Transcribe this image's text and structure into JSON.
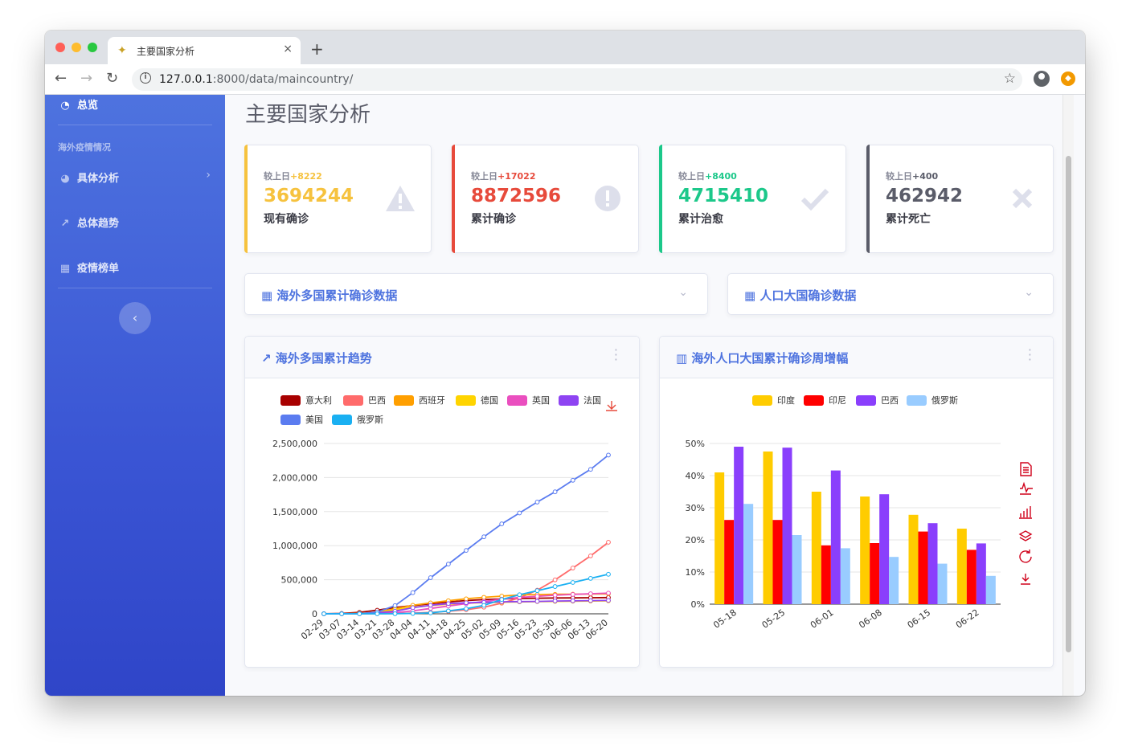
{
  "browser": {
    "tab_title": "主要国家分析",
    "url_host": "127.0.0.1",
    "url_rest": ":8000/data/maincountry/",
    "new_tab_symbol": "+",
    "close_symbol": "×",
    "icons": [
      "back-arrow-icon",
      "forward-arrow-icon",
      "reload-icon",
      "info-icon",
      "star-icon",
      "account-icon",
      "extension-icon"
    ]
  },
  "sidebar": {
    "dashboard_label": "总览",
    "section_heading": "海外疫情情况",
    "items": [
      {
        "label": "具体分析",
        "icon": "pie-chart-icon"
      },
      {
        "label": "总体趋势",
        "icon": "line-chart-icon"
      },
      {
        "label": "疫情榜单",
        "icon": "table-icon"
      }
    ],
    "toggle_icon": "chevron-left-icon"
  },
  "page": {
    "title": "主要国家分析"
  },
  "stats": [
    {
      "delta_prefix": "较上日",
      "delta": "+8222",
      "value": "3694244",
      "label": "现有确诊",
      "color": "#f6c23e",
      "icon": "warning-icon",
      "glyph": "⚠"
    },
    {
      "delta_prefix": "较上日",
      "delta": "+17022",
      "value": "8872596",
      "label": "累计确诊",
      "color": "#e74a3b",
      "icon": "exclamation-circle-icon",
      "glyph": "!"
    },
    {
      "delta_prefix": "较上日",
      "delta": "+8400",
      "value": "4715410",
      "label": "累计治愈",
      "color": "#1cc88a",
      "icon": "check-icon",
      "glyph": "✔"
    },
    {
      "delta_prefix": "较上日",
      "delta": "+400",
      "value": "462942",
      "label": "累计死亡",
      "color": "#5a5c69",
      "icon": "times-icon",
      "glyph": "✖"
    }
  ],
  "collapse_panels": [
    {
      "title": "海外多国累计确诊数据",
      "icon": "table-icon"
    },
    {
      "title": "人口大国确诊数据",
      "icon": "table-icon"
    }
  ],
  "charts": {
    "trend_title": "海外多国累计趋势",
    "weekly_title": "海外人口大国累计确诊周增幅"
  },
  "chart_data": [
    {
      "type": "line",
      "title": "海外多国累计趋势",
      "x": [
        "02-29",
        "03-07",
        "03-14",
        "03-21",
        "03-28",
        "04-04",
        "04-11",
        "04-18",
        "04-25",
        "05-02",
        "05-09",
        "05-16",
        "05-23",
        "05-30",
        "06-06",
        "06-13",
        "06-20"
      ],
      "ylim": [
        0,
        2500000
      ],
      "yticks": [
        "0",
        "500,000",
        "1,000,000",
        "1,500,000",
        "2,000,000",
        "2,500,000"
      ],
      "legend_position": "top",
      "series": [
        {
          "name": "意大利",
          "color": "#a80000",
          "values": [
            1100,
            5900,
            21000,
            53000,
            92000,
            120000,
            147000,
            173000,
            195000,
            209000,
            218000,
            224000,
            229000,
            232000,
            234000,
            236000,
            238000
          ]
        },
        {
          "name": "巴西",
          "color": "#ff6b6b",
          "values": [
            2,
            20,
            100,
            1100,
            3900,
            11000,
            20000,
            36000,
            59000,
            97000,
            156000,
            233000,
            347000,
            498000,
            672000,
            850000,
            1050000
          ]
        },
        {
          "name": "西班牙",
          "color": "#ff9f00",
          "values": [
            80,
            500,
            6400,
            25000,
            73000,
            125000,
            160000,
            192000,
            220000,
            242000,
            260000,
            277000,
            282000,
            286000,
            288000,
            290000,
            293000
          ]
        },
        {
          "name": "德国",
          "color": "#ffd400",
          "values": [
            80,
            800,
            5800,
            22000,
            58000,
            96000,
            122000,
            141000,
            155000,
            164000,
            170000,
            175000,
            179000,
            182000,
            185000,
            187000,
            190000
          ]
        },
        {
          "name": "英国",
          "color": "#ea4fbf",
          "values": [
            20,
            200,
            1140,
            5000,
            17000,
            42000,
            79000,
            114000,
            148000,
            182000,
            215000,
            240000,
            257000,
            272000,
            284000,
            295000,
            303000
          ]
        },
        {
          "name": "法国",
          "color": "#8e44f2",
          "values": [
            100,
            900,
            4500,
            14000,
            38000,
            90000,
            125000,
            150000,
            162000,
            168000,
            176000,
            179000,
            182000,
            188000,
            190000,
            193000,
            196000
          ]
        },
        {
          "name": "美国",
          "color": "#5b7cf0",
          "values": [
            70,
            400,
            2700,
            25000,
            120000,
            310000,
            530000,
            730000,
            930000,
            1130000,
            1320000,
            1480000,
            1640000,
            1790000,
            1960000,
            2120000,
            2330000
          ]
        },
        {
          "name": "俄罗斯",
          "color": "#1ab0f2",
          "values": [
            2,
            10,
            60,
            300,
            1300,
            5400,
            13500,
            43000,
            75000,
            124000,
            210000,
            280000,
            340000,
            400000,
            460000,
            520000,
            580000
          ]
        }
      ]
    },
    {
      "type": "bar",
      "title": "海外人口大国累计确诊周增幅",
      "categories": [
        "05-18",
        "05-25",
        "06-01",
        "06-08",
        "06-15",
        "06-22"
      ],
      "ylim": [
        0,
        50
      ],
      "yticks": [
        "0%",
        "10%",
        "20%",
        "30%",
        "40%",
        "50%"
      ],
      "legend_position": "top",
      "series": [
        {
          "name": "印度",
          "color": "#ffcc00",
          "values": [
            41,
            47.5,
            35,
            33.5,
            27.8,
            23.5
          ]
        },
        {
          "name": "印尼",
          "color": "#ff0000",
          "values": [
            26.2,
            26.2,
            18.3,
            19,
            22.6,
            16.9
          ]
        },
        {
          "name": "巴西",
          "color": "#8a3ffc",
          "values": [
            49,
            48.7,
            41.6,
            34.2,
            25.2,
            18.9
          ]
        },
        {
          "name": "俄罗斯",
          "color": "#99ccff",
          "values": [
            31.2,
            21.5,
            17.4,
            14.7,
            12.6,
            8.8
          ]
        }
      ]
    }
  ]
}
